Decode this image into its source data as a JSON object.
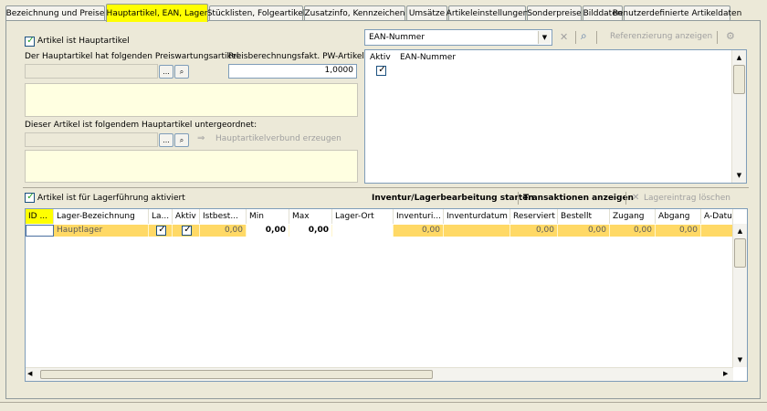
{
  "tabs": [
    {
      "label": "Bezeichnung und Preise",
      "active": false
    },
    {
      "label": "Hauptartikel, EAN, Lager",
      "active": true
    },
    {
      "label": "Stücklisten, Folgeartikel",
      "active": false
    },
    {
      "label": "Zusatzinfo, Kennzeichen",
      "active": false
    },
    {
      "label": "Umsätze",
      "active": false
    },
    {
      "label": "Artikeleinstellungen",
      "active": false
    },
    {
      "label": "Sonderpreise",
      "active": false
    },
    {
      "label": "Bilddaten",
      "active": false
    },
    {
      "label": "Benutzerdefinierte Artikeldaten",
      "active": false
    }
  ],
  "hauptartikel": {
    "checkbox_label": "Artikel ist Hauptartikel",
    "checked": true,
    "preis_label": "Der Hauptartikel hat folgenden Preiswartungsartikel:",
    "faktor_label": "Preisberechnungsfakt. PW-Artikel:",
    "faktor_value": "1,0000",
    "untergeordnet_label": "Dieser Artikel ist folgendem Hauptartikel untergeordnet:",
    "verbund_button": "Hauptartikelverbund erzeugen",
    "browse_label": "...",
    "search_glyph": "⌕"
  },
  "ean": {
    "dropdown_value": "EAN-Nummer",
    "referenz_button": "Referenzierung anzeigen",
    "col_aktiv": "Aktiv",
    "col_ean": "EAN-Nummer",
    "row_checked": true
  },
  "lager": {
    "checkbox_label": "Artikel ist für Lagerführung aktiviert",
    "checked": true,
    "inventur_button": "Inventur/Lagerbearbeitung starten",
    "transaktionen_button": "Transaktionen anzeigen",
    "loeschen_button": "Lagereintrag löschen",
    "columns": [
      "ID ...",
      "Lager-Bezeichnung",
      "La...",
      "Aktiv",
      "Istbest...",
      "Min",
      "Max",
      "Lager-Ort",
      "Inventuri...",
      "Inventurdatum",
      "Reserviert",
      "Bestellt",
      "Zugang",
      "Abgang",
      "A-Datu"
    ],
    "row": {
      "id": "",
      "bezeichnung": "Hauptlager",
      "la": true,
      "aktiv": true,
      "istbestand": "0,00",
      "min": "0,00",
      "max": "0,00",
      "lagerort": "",
      "inventuri": "0,00",
      "inventurdatum": "",
      "reserviert": "0,00",
      "bestellt": "0,00",
      "zugang": "0,00",
      "abgang": "0,00",
      "adatum": ""
    }
  },
  "colors": {
    "active_tab": "#ffff00",
    "row_highlight": "#ffd966",
    "cream": "#ffffe1",
    "check": "#21a121"
  }
}
